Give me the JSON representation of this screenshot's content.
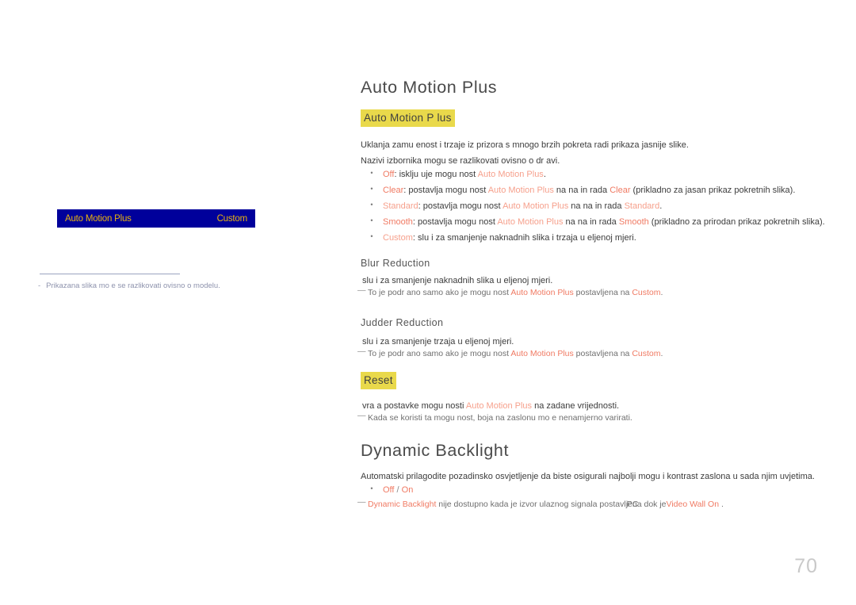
{
  "page": {
    "number": "70"
  },
  "left_panel": {
    "osd": {
      "setting_label": "Auto Motion Plus",
      "setting_value": "Custom"
    },
    "footnote": {
      "dash": "-",
      "text": "Prikazana slika mo e se razlikovati ovisno o modelu."
    }
  },
  "sections": {
    "auto_motion_plus": {
      "title": "Auto Motion Plus",
      "sub_title": "Auto Motion P lus",
      "intro_1": "Uklanja zamu enost i trzaje iz prizora s mnogo brzih pokreta radi prikaza jasnije slike.",
      "intro_2": "Nazivi izbornika mogu se razlikovati ovisno o dr avi.",
      "bullets": [
        {
          "dot": "•",
          "option": "Off",
          "text_1": ": isklju uje mogu nost ",
          "ref": "Auto Motion Plus",
          "text_2": "."
        },
        {
          "dot": "•",
          "option": "Clear",
          "text_1": ": postavlja mogu nost ",
          "ref": "Auto Motion Plus",
          "text_2": " na na in rada ",
          "mode": "Clear",
          "text_3": " (prikladno za jasan prikaz pokretnih slika)."
        },
        {
          "dot": "•",
          "option": "Standard",
          "text_1": ": postavlja mogu nost ",
          "ref": "Auto Motion Plus",
          "text_2": " na na in rada ",
          "mode": "Standard",
          "text_3": "."
        },
        {
          "dot": "•",
          "option": "Smooth",
          "text_1": ": postavlja mogu nost ",
          "ref": "Auto Motion Plus",
          "text_2": " na na in rada ",
          "mode": "Smooth",
          "text_3": " (prikladno za prirodan prikaz pokretnih slika)."
        },
        {
          "dot": "•",
          "option": "Custom",
          "text_1": ": slu i za smanjenje naknadnih slika i trzaja u  eljenoj mjeri."
        }
      ],
      "blur_reduction": {
        "title": "Blur Reduction",
        "description": "slu i za smanjenje naknadnih slika u  eljenoj mjeri.",
        "note": {
          "marker": "—",
          "text_1": "To je podr ano samo ako je mogu nost ",
          "ref": "Auto Motion Plus",
          "text_2": " postavljena na ",
          "value": "Custom",
          "text_3": "."
        }
      },
      "judder_reduction": {
        "title": "Judder Reduction",
        "description": "slu i za smanjenje trzaja u  eljenoj mjeri.",
        "note": {
          "marker": "—",
          "text_1": "To je podr ano samo ako je mogu nost ",
          "ref": "Auto Motion Plus",
          "text_2": " postavljena na ",
          "value": "Custom",
          "text_3": "."
        }
      },
      "reset": {
        "sub_title": "Reset",
        "description_1": "vra a postavke mogu nosti ",
        "description_ref": "Auto Motion Plus",
        "description_2": " na zadane vrijednosti.",
        "note": {
          "marker": "—",
          "text": "Kada se koristi ta mogu nost, boja na zaslonu mo e nenamjerno varirati."
        }
      }
    },
    "dynamic_backlight": {
      "title": "Dynamic Backlight",
      "description": "Automatski prilagodite pozadinsko osvjetljenje da biste osigurali najbolji mogu i kontrast zaslona u sada njim uvjetima.",
      "bullet": {
        "dot": "•",
        "option_off": "Off",
        "separator": " / ",
        "option_on": "On"
      },
      "note": {
        "marker": "—",
        "ref": "Dynamic Backlight",
        "text_1": " nije dostupno kada je izvor ulaznog signala postavljen",
        "overlap": "PC",
        "text_2": "a dok je ",
        "ref_2": "Video Wall On",
        "text_3": " ."
      }
    }
  },
  "colors": {
    "highlight_yellow": "#e9d94b",
    "osd_navy": "#00009b",
    "osd_amber": "#e9b310",
    "accent_red": "#f07a63",
    "accent_red_light": "#f6a08c",
    "body_text": "#3c3c3c",
    "page_number_grey": "#c9c9c9"
  }
}
